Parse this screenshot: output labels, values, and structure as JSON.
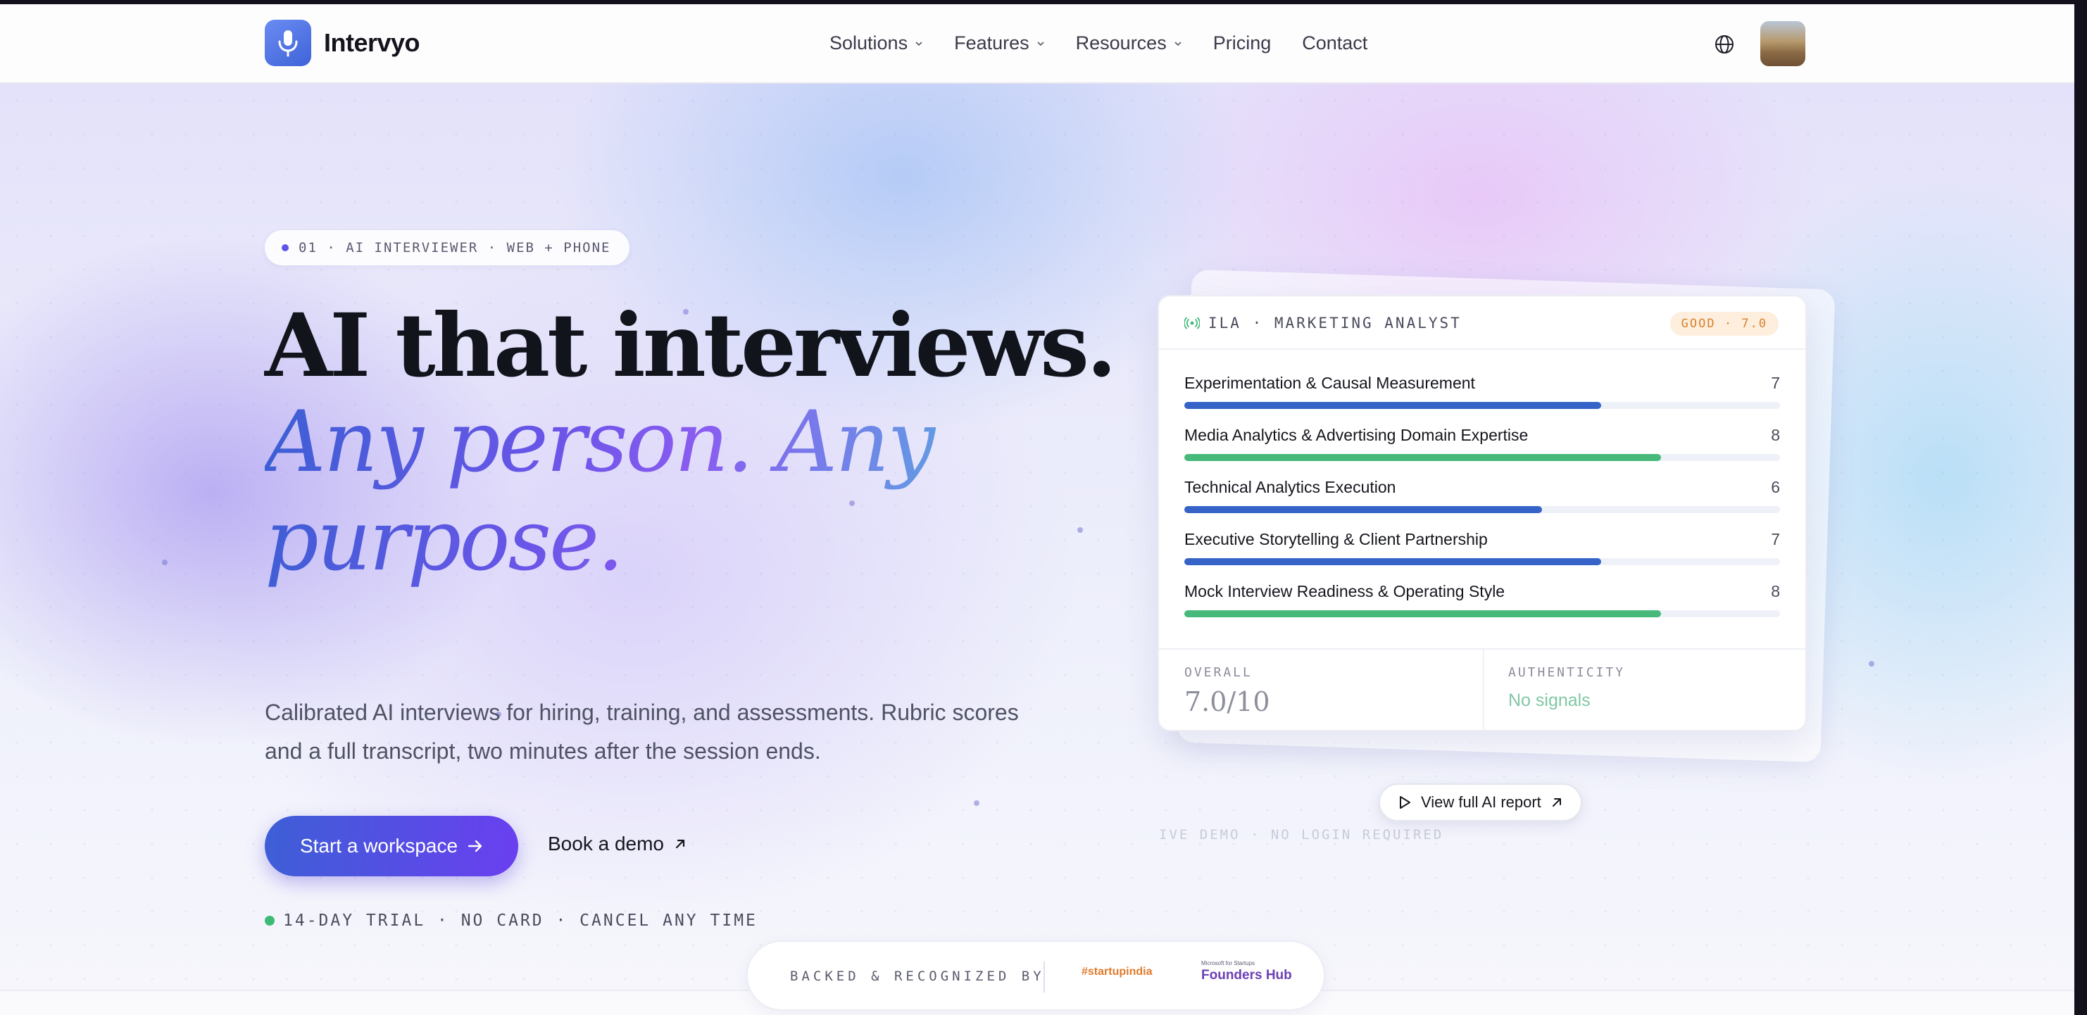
{
  "brand": {
    "name": "Intervyo"
  },
  "nav": {
    "items": [
      {
        "label": "Solutions",
        "has_menu": true
      },
      {
        "label": "Features",
        "has_menu": true
      },
      {
        "label": "Resources",
        "has_menu": true
      },
      {
        "label": "Pricing",
        "has_menu": false
      },
      {
        "label": "Contact",
        "has_menu": false
      }
    ],
    "globe_icon": "globe-icon",
    "avatar_icon": "user-avatar"
  },
  "hero": {
    "tag": "01 · AI INTERVIEWER · WEB + PHONE",
    "headline": "AI that interviews.",
    "subheadline": "Any person. Any purpose.",
    "lead": "Calibrated AI interviews for hiring, training, and assessments. Rubric scores and a full transcript, two minutes after the session ends.",
    "primary_cta": "Start a workspace",
    "secondary_cta": "Book a demo",
    "trial_note": "14-DAY TRIAL · NO CARD · CANCEL ANY TIME"
  },
  "report_card": {
    "title": "ILA · MARKETING ANALYST",
    "badge": "GOOD · 7.0",
    "rows": [
      {
        "label": "Experimentation & Causal Measurement",
        "score": "7",
        "fraction": 0.7,
        "color": "#3563c7"
      },
      {
        "label": "Media Analytics & Advertising Domain Expertise",
        "score": "8",
        "fraction": 0.8,
        "color": "#46b97b"
      },
      {
        "label": "Technical Analytics Execution",
        "score": "6",
        "fraction": 0.6,
        "color": "#3563c7"
      },
      {
        "label": "Executive Storytelling & Client Partnership",
        "score": "7",
        "fraction": 0.7,
        "color": "#3563c7"
      },
      {
        "label": "Mock Interview Readiness & Operating Style",
        "score": "8",
        "fraction": 0.8,
        "color": "#46b97b"
      }
    ],
    "overall_label": "OVERALL",
    "overall_value": "7.0/10",
    "authenticity_label": "AUTHENTICITY",
    "authenticity_value": "No signals",
    "report_button": "View full AI report",
    "live_demo_note": "IVE DEMO · NO LOGIN REQUIRED"
  },
  "backed": {
    "label": "BACKED & RECOGNIZED BY",
    "logo1": "#startupindia",
    "logo2_small": "Microsoft for Startups",
    "logo2_big": "Founders Hub"
  },
  "colors": {
    "accent": "#4a5fe0",
    "purple": "#6a3ff0",
    "green": "#46b97b",
    "badge_orange": "#d9822e"
  }
}
